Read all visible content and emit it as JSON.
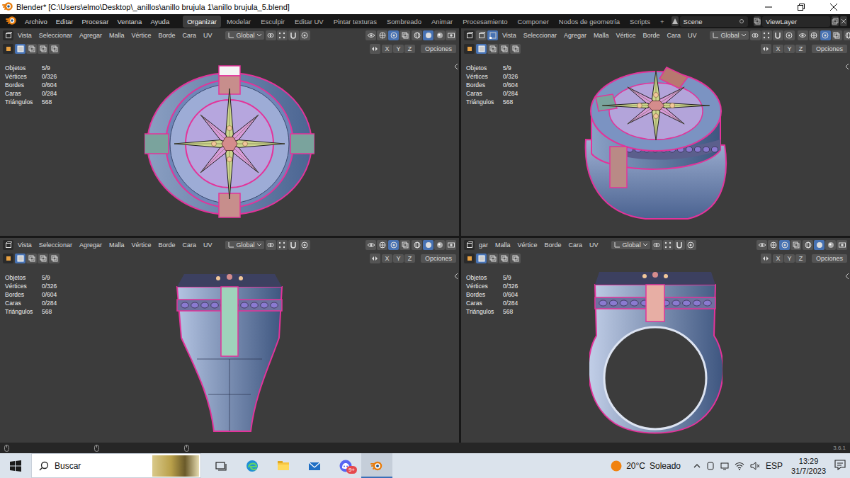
{
  "window": {
    "title": "Blender* [C:\\Users\\elmo\\Desktop\\_anillos\\anillo brujula 1\\anillo brujula_5.blend]"
  },
  "menu": [
    "Archivo",
    "Editar",
    "Procesar",
    "Ventana",
    "Ayuda"
  ],
  "workspaces": [
    {
      "label": "Organizar",
      "selected": true
    },
    {
      "label": "Modelar",
      "selected": false
    },
    {
      "label": "Esculpir",
      "selected": false
    },
    {
      "label": "Editar UV",
      "selected": false
    },
    {
      "label": "Pintar texturas",
      "selected": false
    },
    {
      "label": "Sombreado",
      "selected": false
    },
    {
      "label": "Animar",
      "selected": false
    },
    {
      "label": "Procesamiento",
      "selected": false
    },
    {
      "label": "Componer",
      "selected": false
    },
    {
      "label": "Nodos de geometría",
      "selected": false
    },
    {
      "label": "Scripts",
      "selected": false
    }
  ],
  "add_workspace": "+",
  "scene": "Scene",
  "view_layer": "ViewLayer",
  "viewports": [
    {
      "kind": "top",
      "header": [
        "Vista",
        "Seleccionar",
        "Agregar",
        "Malla",
        "Vértice",
        "Borde",
        "Cara",
        "UV"
      ],
      "orientation": "Global",
      "axes": [
        "X",
        "Y",
        "Z"
      ],
      "options": "Opciones",
      "stats": [
        {
          "label": "Objetos",
          "value": "5/9"
        },
        {
          "label": "Vértices",
          "value": "0/326"
        },
        {
          "label": "Bordes",
          "value": "0/604"
        },
        {
          "label": "Caras",
          "value": "0/284"
        },
        {
          "label": "Triángulos",
          "value": "568"
        }
      ]
    },
    {
      "kind": "perspective",
      "header": [
        "Vista",
        "Seleccionar",
        "Agregar",
        "Malla",
        "Vértice",
        "Borde",
        "Cara",
        "UV"
      ],
      "orientation": "Global",
      "axes": [
        "X",
        "Y",
        "Z"
      ],
      "options": "Opciones",
      "stats": [
        {
          "label": "Objetos",
          "value": "5/9"
        },
        {
          "label": "Vértices",
          "value": "0/326"
        },
        {
          "label": "Bordes",
          "value": "0/604"
        },
        {
          "label": "Caras",
          "value": "0/284"
        },
        {
          "label": "Triángulos",
          "value": "568"
        }
      ]
    },
    {
      "kind": "side",
      "header": [
        "Vista",
        "Seleccionar",
        "Agregar",
        "Malla",
        "Vértice",
        "Borde",
        "Cara",
        "UV"
      ],
      "orientation": "Global",
      "axes": [
        "X",
        "Y",
        "Z"
      ],
      "options": "Opciones",
      "stats": [
        {
          "label": "Objetos",
          "value": "5/9"
        },
        {
          "label": "Vértices",
          "value": "0/326"
        },
        {
          "label": "Bordes",
          "value": "0/604"
        },
        {
          "label": "Caras",
          "value": "0/284"
        },
        {
          "label": "Triángulos",
          "value": "568"
        }
      ]
    },
    {
      "kind": "front",
      "header": [
        "gar",
        "Malla",
        "Vértice",
        "Borde",
        "Cara",
        "UV"
      ],
      "orientation": "Global",
      "axes": [
        "X",
        "Y",
        "Z"
      ],
      "options": "Opciones",
      "stats": [
        {
          "label": "Objetos",
          "value": "5/9"
        },
        {
          "label": "Vértices",
          "value": "0/326"
        },
        {
          "label": "Bordes",
          "value": "0/604"
        },
        {
          "label": "Caras",
          "value": "0/284"
        },
        {
          "label": "Triángulos",
          "value": "568"
        }
      ]
    }
  ],
  "status_bar": {
    "version": "3.6.1"
  },
  "taskbar": {
    "search": "Buscar",
    "apps": [
      {
        "kind": "taskview",
        "active": false
      },
      {
        "kind": "edge",
        "active": false
      },
      {
        "kind": "explorer",
        "active": false
      },
      {
        "kind": "mail",
        "active": false
      },
      {
        "kind": "discord",
        "active": false,
        "badge": "9+"
      },
      {
        "kind": "blender",
        "active": true
      }
    ],
    "weather_temp": "20°C",
    "weather_text": "Soleado",
    "language": "ESP",
    "time": "13:29",
    "date": "31/7/2023"
  }
}
